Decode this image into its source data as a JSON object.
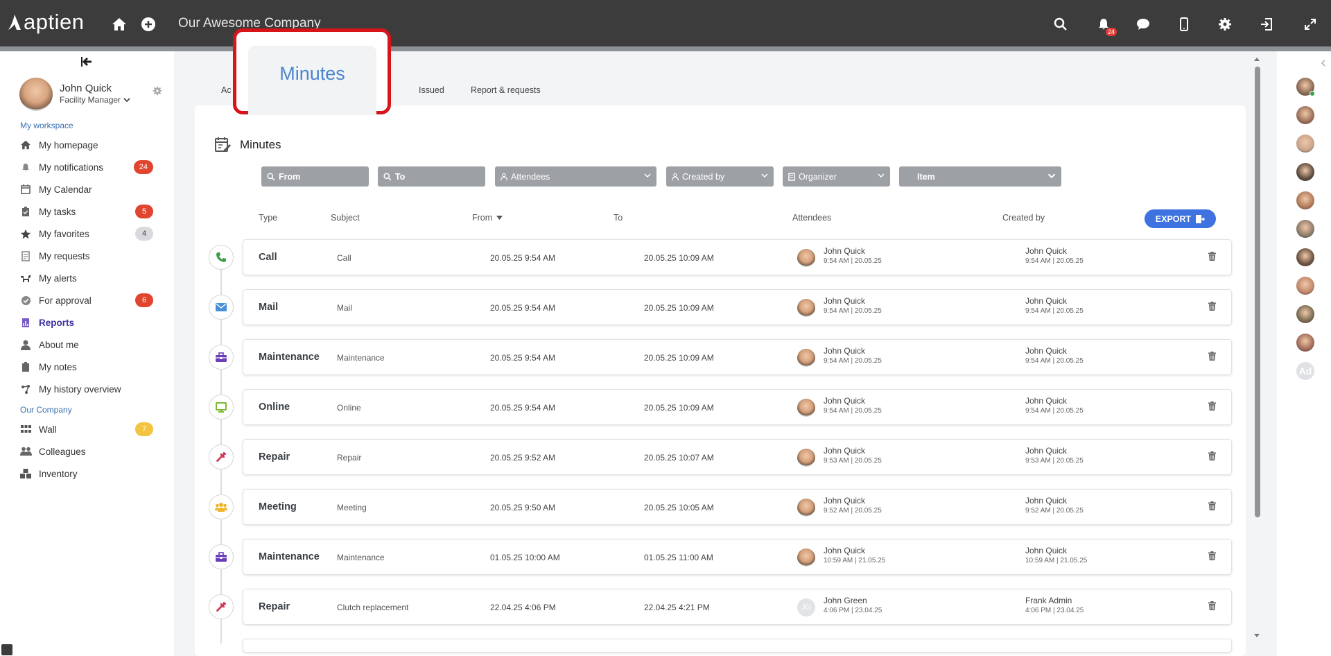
{
  "topbar": {
    "logo_text": "aptien",
    "company": "Our Awesome Company",
    "notifications_count": "24"
  },
  "user": {
    "name": "John Quick",
    "role": "Facility Manager"
  },
  "sidebar": {
    "section_workspace": "My workspace",
    "section_company": "Our Company",
    "items": [
      {
        "label": "My homepage",
        "icon": "home-icon"
      },
      {
        "label": "My notifications",
        "icon": "bell-icon",
        "badge": "24"
      },
      {
        "label": "My Calendar",
        "icon": "calendar-icon"
      },
      {
        "label": "My tasks",
        "icon": "clipboard-icon",
        "badge": "5"
      },
      {
        "label": "My favorites",
        "icon": "star-icon",
        "badge": "4"
      },
      {
        "label": "My requests",
        "icon": "document-icon"
      },
      {
        "label": "My alerts",
        "icon": "dog-icon"
      },
      {
        "label": "For approval",
        "icon": "check-circle-icon",
        "badge": "6"
      },
      {
        "label": "Reports",
        "icon": "chart-icon"
      },
      {
        "label": "About me",
        "icon": "person-icon"
      },
      {
        "label": "My notes",
        "icon": "clipboard-icon"
      },
      {
        "label": "My history overview",
        "icon": "history-icon"
      }
    ],
    "company_items": [
      {
        "label": "Wall",
        "icon": "grid-icon",
        "badge": "7"
      },
      {
        "label": "Colleagues",
        "icon": "people-icon"
      },
      {
        "label": "Inventory",
        "icon": "boxes-icon"
      }
    ]
  },
  "tabs": {
    "partial": "Ac",
    "issued": "Issued",
    "reports": "Report & requests"
  },
  "popup": {
    "label": "Minutes"
  },
  "card": {
    "title": "Minutes",
    "filters": {
      "from": "From",
      "to": "To",
      "attendees": "Attendees",
      "created_by": "Created by",
      "organizer": "Organizer",
      "item": "Item"
    },
    "columns": {
      "type": "Type",
      "subject": "Subject",
      "from": "From",
      "to": "To",
      "attendees": "Attendees",
      "created_by": "Created by"
    },
    "export_label": "EXPORT"
  },
  "rows": [
    {
      "type": "Call",
      "subject": "Call",
      "from": "20.05.25 9:54 AM",
      "to": "20.05.25 10:09 AM",
      "att_name": "John Quick",
      "att_time": "9:54 AM | 20.05.25",
      "cb_name": "John Quick",
      "cb_time": "9:54 AM | 20.05.25",
      "icon": "phone-icon",
      "color": "#3aa046"
    },
    {
      "type": "Mail",
      "subject": "Mail",
      "from": "20.05.25 9:54 AM",
      "to": "20.05.25 10:09 AM",
      "att_name": "John Quick",
      "att_time": "9:54 AM | 20.05.25",
      "cb_name": "John Quick",
      "cb_time": "9:54 AM | 20.05.25",
      "icon": "mail-icon",
      "color": "#4a90d9"
    },
    {
      "type": "Maintenance",
      "subject": "Maintenance",
      "from": "20.05.25 9:54 AM",
      "to": "20.05.25 10:09 AM",
      "att_name": "John Quick",
      "att_time": "9:54 AM | 20.05.25",
      "cb_name": "John Quick",
      "cb_time": "9:54 AM | 20.05.25",
      "icon": "toolbox-icon",
      "color": "#6a3fb8"
    },
    {
      "type": "Online",
      "subject": "Online",
      "from": "20.05.25 9:54 AM",
      "to": "20.05.25 10:09 AM",
      "att_name": "John Quick",
      "att_time": "9:54 AM | 20.05.25",
      "cb_name": "John Quick",
      "cb_time": "9:54 AM | 20.05.25",
      "icon": "monitor-icon",
      "color": "#7cb82f"
    },
    {
      "type": "Repair",
      "subject": "Repair",
      "from": "20.05.25 9:52 AM",
      "to": "20.05.25 10:07 AM",
      "att_name": "John Quick",
      "att_time": "9:53 AM | 20.05.25",
      "cb_name": "John Quick",
      "cb_time": "9:53 AM | 20.05.25",
      "icon": "wrench-icon",
      "color": "#d13a5a"
    },
    {
      "type": "Meeting",
      "subject": "Meeting",
      "from": "20.05.25 9:50 AM",
      "to": "20.05.25 10:05 AM",
      "att_name": "John Quick",
      "att_time": "9:52 AM | 20.05.25",
      "cb_name": "John Quick",
      "cb_time": "9:52 AM | 20.05.25",
      "icon": "group-icon",
      "color": "#f0b429"
    },
    {
      "type": "Maintenance",
      "subject": "Maintenance",
      "from": "01.05.25 10:00 AM",
      "to": "01.05.25 11:00 AM",
      "att_name": "John Quick",
      "att_time": "10:59 AM | 21.05.25",
      "cb_name": "John Quick",
      "cb_time": "10:59 AM | 21.05.25",
      "icon": "toolbox-icon",
      "color": "#6a3fb8"
    },
    {
      "type": "Repair",
      "subject": "Clutch replacement",
      "from": "22.04.25 4:06 PM",
      "to": "22.04.25 4:21 PM",
      "att_name": "John Green",
      "att_time": "4:06 PM | 23.04.25",
      "att_initials": "JG",
      "cb_name": "Frank Admin",
      "cb_time": "4:06 PM | 23.04.25",
      "icon": "wrench-icon",
      "color": "#d13a5a"
    }
  ],
  "right_avatars_last": "Ad"
}
